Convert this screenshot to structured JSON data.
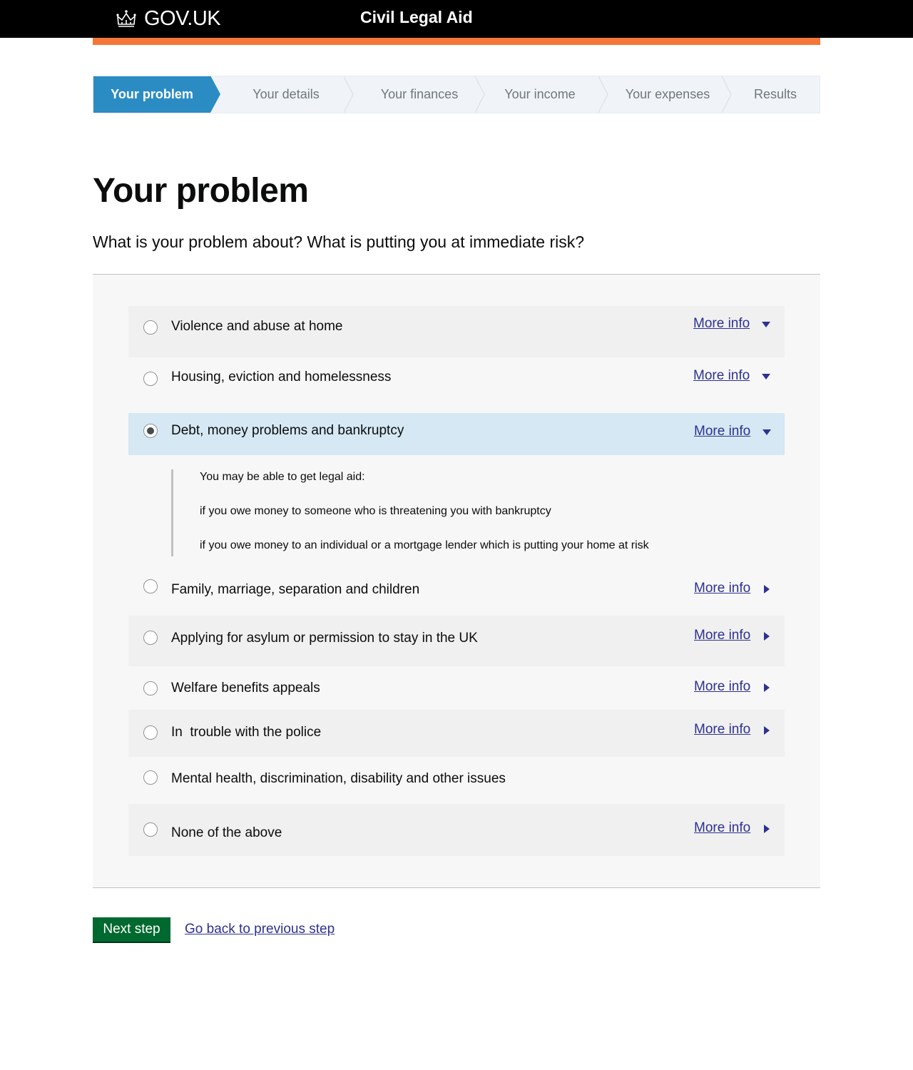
{
  "header": {
    "logo_text": "GOV.UK",
    "service_name": "Civil Legal Aid",
    "accent_color": "#f47738"
  },
  "steps": [
    {
      "label": "Your problem",
      "active": true
    },
    {
      "label": "Your details",
      "active": false
    },
    {
      "label": "Your finances",
      "active": false
    },
    {
      "label": "Your income",
      "active": false
    },
    {
      "label": "Your expenses",
      "active": false
    },
    {
      "label": "Results",
      "active": false
    }
  ],
  "page": {
    "title": "Your problem",
    "question": "What is your problem about? What is putting you at immediate risk?"
  },
  "more_info_label": "More info",
  "options": [
    {
      "label": "Violence and abuse at home",
      "more_info": "More info",
      "expanded": false,
      "selected": false
    },
    {
      "label": "Housing, eviction and homelessness",
      "more_info": "More info",
      "expanded": false,
      "selected": false
    },
    {
      "label": "Debt, money problems and bankruptcy",
      "more_info": "More info",
      "expanded": true,
      "selected": true
    },
    {
      "label": "Family, marriage, separation and children",
      "more_info": "More info",
      "expanded": false,
      "selected": false
    },
    {
      "label": "Applying for asylum or permission to stay in the UK",
      "more_info": "More info",
      "expanded": false,
      "selected": false
    },
    {
      "label": "Welfare benefits appeals",
      "more_info": "More info",
      "expanded": false,
      "selected": false
    },
    {
      "label": "In  trouble with the police",
      "more_info": "More info",
      "expanded": false,
      "selected": false
    },
    {
      "label": "Mental health, discrimination, disability and other issues",
      "more_info": null,
      "expanded": false,
      "selected": false
    },
    {
      "label": "None of the above",
      "more_info": "More info",
      "expanded": false,
      "selected": false
    }
  ],
  "debt_details": {
    "intro": "You may be able to get legal aid:",
    "items": [
      "if you owe money to someone who is threatening you with bankruptcy",
      "if you owe money to an individual or a mortgage lender which is putting your home at risk"
    ]
  },
  "actions": {
    "next_label": "Next step",
    "back_label": "Go back to previous step"
  }
}
